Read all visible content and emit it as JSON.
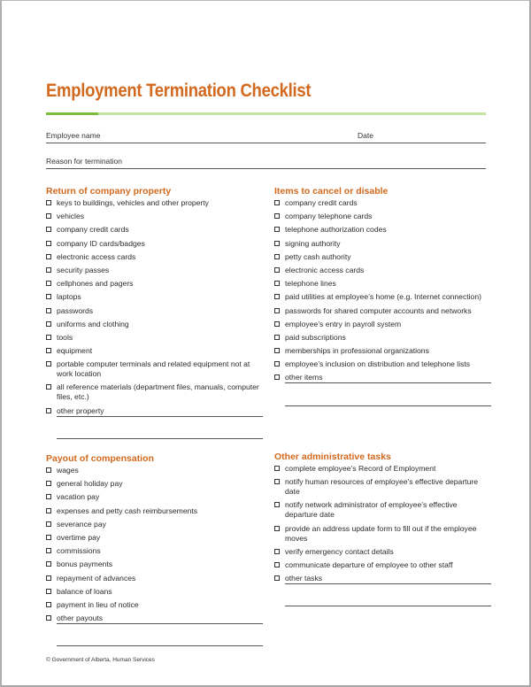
{
  "document": {
    "title": "Employment Termination Checklist",
    "fields": {
      "employee_name": "Employee name",
      "date": "Date",
      "reason": "Reason for termination"
    },
    "sections": {
      "return_property": {
        "title": "Return of company property",
        "items": [
          "keys to buildings, vehicles and other property",
          "vehicles",
          "company credit cards",
          "company ID cards/badges",
          "electronic access cards",
          "security passes",
          "cellphones and pagers",
          "laptops",
          "passwords",
          "uniforms and clothing",
          "tools",
          "equipment",
          "portable computer terminals and related equipment not at work location",
          "all reference materials (department files, manuals, computer files, etc.)"
        ],
        "other": "other property"
      },
      "cancel_disable": {
        "title": "Items to cancel or disable",
        "items": [
          "company credit cards",
          "company telephone cards",
          "telephone authorization codes",
          "signing authority",
          "petty cash authority",
          "electronic access cards",
          "telephone lines",
          "paid utilities at employee’s home (e.g. Internet connection)",
          "passwords for shared computer accounts and networks",
          "employee’s entry in payroll system",
          "paid subscriptions",
          "memberships in professional organizations",
          "employee’s inclusion on distribution and telephone lists"
        ],
        "other": "other items"
      },
      "payout": {
        "title": "Payout of compensation",
        "items": [
          "wages",
          "general holiday pay",
          "vacation pay",
          "expenses and petty cash reimbursements",
          "severance pay",
          "overtime pay",
          "commissions",
          "bonus payments",
          "repayment of advances",
          "balance of loans",
          "payment in lieu of notice"
        ],
        "other": "other payouts"
      },
      "admin_tasks": {
        "title": "Other administrative tasks",
        "items": [
          "complete employee’s Record of Employment",
          "notify human resources of employee’s effective departure date",
          "notify network administrator of employee’s effective departure date",
          "provide an address update form to fill out if the employee moves",
          "verify emergency contact details",
          "communicate departure of employee to other staff"
        ],
        "other": "other tasks"
      }
    },
    "footer": "© Government of Alberta, Human Services"
  }
}
